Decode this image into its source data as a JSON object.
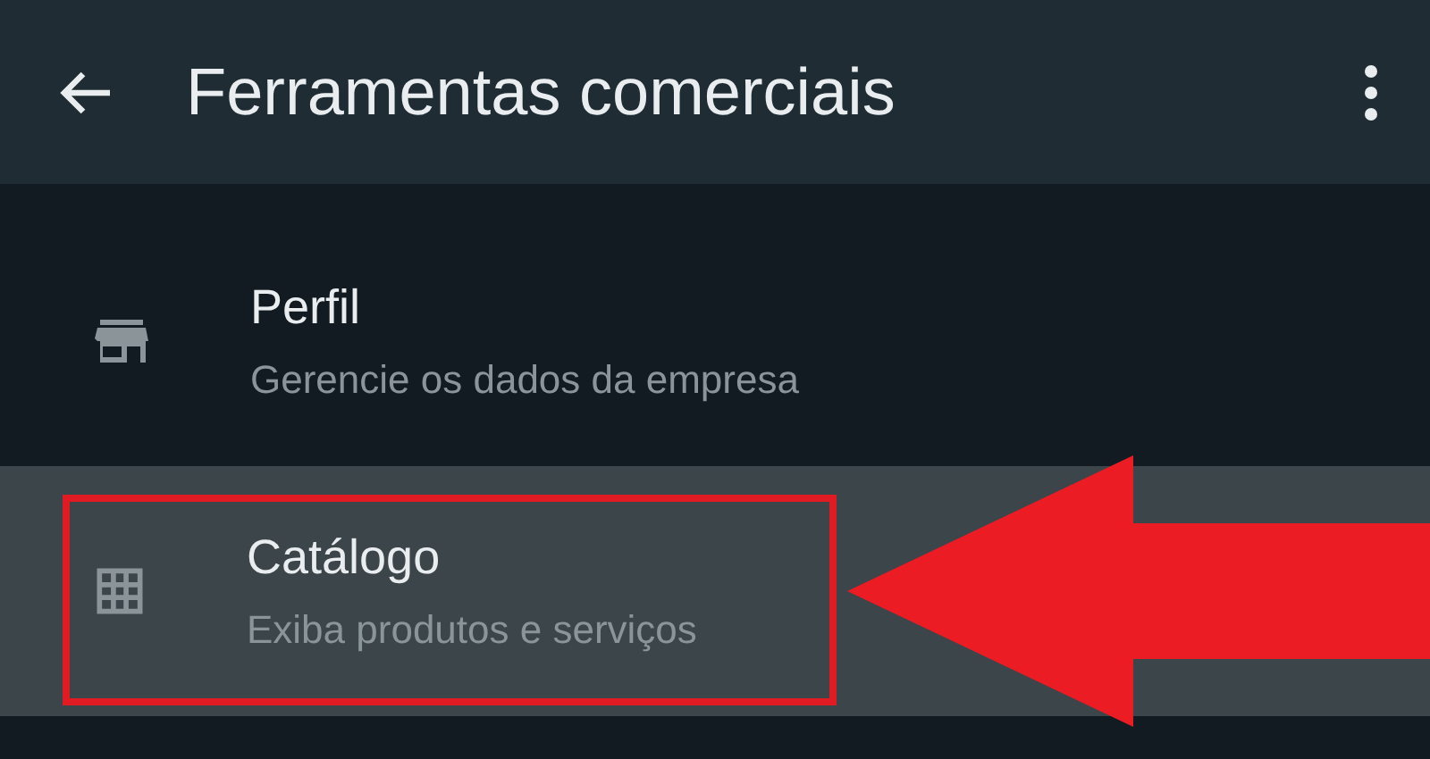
{
  "app_bar": {
    "title": "Ferramentas comerciais"
  },
  "items": [
    {
      "kind": "store",
      "title": "Perfil",
      "subtitle": "Gerencie os dados da empresa",
      "selected": false
    },
    {
      "kind": "grid",
      "title": "Catálogo",
      "subtitle": "Exiba produtos e serviços",
      "selected": true
    }
  ]
}
